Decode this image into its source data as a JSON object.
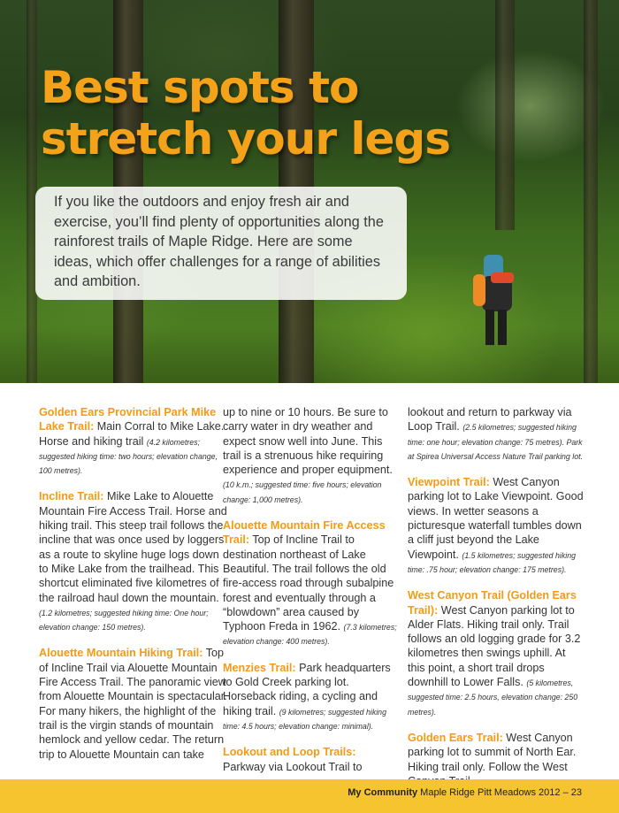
{
  "title_lines": [
    "Best spots to",
    "stretch your legs"
  ],
  "intro": "If you like the outdoors and enjoy fresh air and exercise, you’ll find plenty of opportunities along the rainforest trails of Maple Ridge. Here are some ideas, which offer challenges for a range of abilities and ambition.",
  "columns": [
    [
      {
        "heading": "Golden Ears Provincial Park Mike Lake Trail:",
        "text": " Main Corral to Mike Lake. Horse and hiking trail ",
        "note": "(4.2 kilometres; suggested hiking time: two hours; elevation change, 100 metres)."
      },
      {
        "heading": "Incline Trail:",
        "text": " Mike Lake to Alouette Mountain Fire Access Trail. Horse and hiking trail. This steep trail follows the incline that was once used by loggers as a route to skyline huge logs down to Mike Lake from the trailhead. This shortcut eliminated five kilometres of the railroad haul down the mountain. ",
        "note": "(1.2 kilometres; suggested hiking time: One hour; elevation change: 150 metres)."
      },
      {
        "heading": "Alouette Mountain Hiking Trail:",
        "text": " Top of Incline Trail via Alouette Mountain Fire Access Trail. The panoramic view from Alouette Mountain is spectacular. For many hikers, the highlight of the trail is the virgin stands of mountain hemlock and yellow cedar. The return trip to Alouette Mountain can take",
        "note": ""
      }
    ],
    [
      {
        "heading": "",
        "text": "up to nine or 10 hours. Be sure to carry water in dry weather and expect snow well into June. This trail is a strenuous hike requiring experience and proper equipment. ",
        "note": "(10 k.m.; suggested time: five hours; elevation change: 1,000 metres)."
      },
      {
        "heading": "Alouette Mountain Fire Access Trail:",
        "text": " Top of Incline Trail to destination northeast of Lake Beautiful. The trail follows the old fire-access road through subalpine forest and eventually through a “blowdown” area caused by Typhoon Freda in 1962. ",
        "note": "(7.3 kilometres; elevation change: 400 metres)."
      },
      {
        "heading": "Menzies Trail:",
        "text": " Park headquarters to Gold Creek parking lot. Horseback riding, a cycling and hiking trail. ",
        "note": "(9 kilometres; suggested hiking time: 4.5 hours; elevation change: minimal)."
      },
      {
        "heading": "Lookout and Loop Trails:",
        "text": " Parkway via Lookout Trail to",
        "note": ""
      }
    ],
    [
      {
        "heading": "",
        "text": "lookout and return to parkway via Loop Trail. ",
        "note": "(2.5 kilometres; suggested hiking time: one hour; elevation change: 75 metres). Park at Spirea Universal Access Nature Trail parking lot."
      },
      {
        "heading": "Viewpoint Trail:",
        "text": " West Canyon parking lot to Lake Viewpoint. Good views. In wetter seasons a picturesque waterfall tumbles down a cliff just beyond the Lake Viewpoint. ",
        "note": "(1.5 kilometres; suggested hiking time: .75 hour; elevation change: 175 metres)."
      },
      {
        "heading": "West Canyon Trail (Golden Ears Trail):",
        "text": " West Canyon parking lot to Alder Flats. Hiking trail only. Trail follows an old logging grade for 3.2 kilometres then swings uphill. At this point, a short trail drops downhill to Lower Falls. ",
        "note": "(5 kilometres, suggested time: 2.5 hours, elevation change: 250 metres)."
      },
      {
        "heading": "Golden Ears Trail:",
        "text": " West Canyon parking lot to summit of North Ear. Hiking trail only. Follow the West Canyon Trail",
        "note": ""
      }
    ]
  ],
  "footer": {
    "bold": "My Community",
    "rest": " Maple Ridge Pitt Meadows 2012 – 23"
  },
  "colors": {
    "accent": "#f39a16",
    "footer_bg": "#f6c42e"
  }
}
